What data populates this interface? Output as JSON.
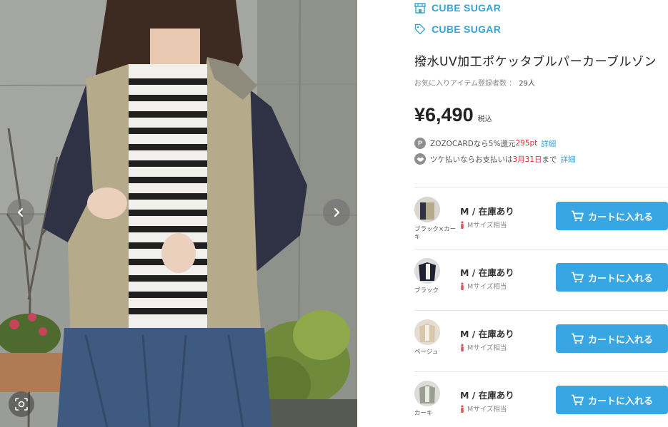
{
  "photo": {
    "prev_icon": "chevron-left-icon",
    "next_icon": "chevron-right-icon",
    "lens_icon": "visual-search-icon"
  },
  "product": {
    "shop_name": "CUBE SUGAR",
    "brand_name": "CUBE SUGAR",
    "shop_icon": "store-icon",
    "brand_icon": "tag-icon",
    "title": "撥水UV加工ポケッタブルパーカーブルゾン",
    "favorites_label": "お気に入りアイテム登録者数 ：",
    "favorites_count": "29人",
    "price": "¥6,490",
    "tax_label": "税込",
    "points": {
      "badge": "P",
      "text_before": "ZOZOCARDなら5%還元",
      "value": "295pt",
      "link": "詳細"
    },
    "deferred": {
      "text_before": "ツケ払いならお支払いは",
      "date": "3月31日",
      "text_after": "まで",
      "link": "詳細"
    }
  },
  "skus": [
    {
      "color": "ブラック×カーキ",
      "size_stock": "M / 在庫あり",
      "size_note": "Mサイズ相当",
      "cart_label": "カートに入れる"
    },
    {
      "color": "ブラック",
      "size_stock": "M / 在庫あり",
      "size_note": "Mサイズ相当",
      "cart_label": "カートに入れる"
    },
    {
      "color": "ベージュ",
      "size_stock": "M / 在庫あり",
      "size_note": "Mサイズ相当",
      "cart_label": "カートに入れる"
    },
    {
      "color": "カーキ",
      "size_stock": "M / 在庫あり",
      "size_note": "Mサイズ相当",
      "cart_label": "カートに入れる"
    }
  ],
  "colors": {
    "accent": "#35a5d4",
    "cart_button": "#38a6e3",
    "sale_red": "#d2302f"
  }
}
